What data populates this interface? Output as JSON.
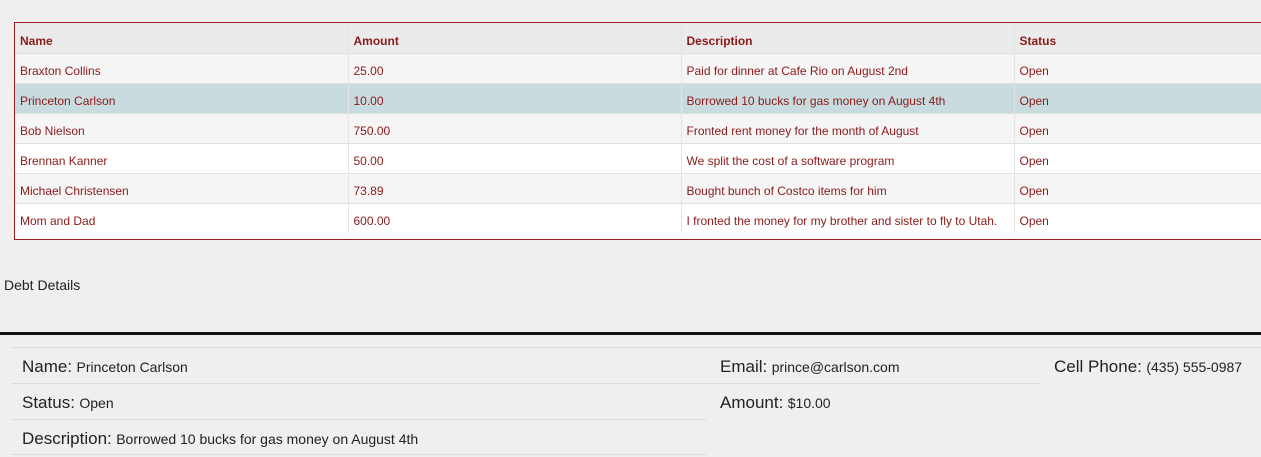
{
  "table": {
    "headers": [
      "Name",
      "Amount",
      "Description",
      "Status"
    ],
    "rows": [
      {
        "name": "Braxton Collins",
        "amount": "25.00",
        "description": "Paid for dinner at Cafe Rio on August 2nd",
        "status": "Open"
      },
      {
        "name": "Princeton Carlson",
        "amount": "10.00",
        "description": "Borrowed 10 bucks for gas money on August 4th",
        "status": "Open"
      },
      {
        "name": "Bob Nielson",
        "amount": "750.00",
        "description": "Fronted rent money for the month of August",
        "status": "Open"
      },
      {
        "name": "Brennan Kanner",
        "amount": "50.00",
        "description": "We split the cost of a software program",
        "status": "Open"
      },
      {
        "name": "Michael Christensen",
        "amount": "73.89",
        "description": "Bought bunch of Costco items for him",
        "status": "Open"
      },
      {
        "name": "Mom and Dad",
        "amount": "600.00",
        "description": "I fronted the money for my brother and sister to fly to Utah.",
        "status": "Open"
      }
    ],
    "selected_index": 1
  },
  "details": {
    "title": "Debt Details",
    "name_label": "Name:",
    "name_value": "Princeton Carlson",
    "email_label": "Email:",
    "email_value": "prince@carlson.com",
    "phone_label": "Cell Phone:",
    "phone_value": "(435) 555-0987",
    "status_label": "Status:",
    "status_value": "Open",
    "amount_label": "Amount:",
    "amount_value": "$10.00",
    "description_label": "Description:",
    "description_value": "Borrowed 10 bucks for gas money on August 4th"
  },
  "colors": {
    "accent_text": "#8b1a1a",
    "selected_row": "#c8dce0"
  }
}
